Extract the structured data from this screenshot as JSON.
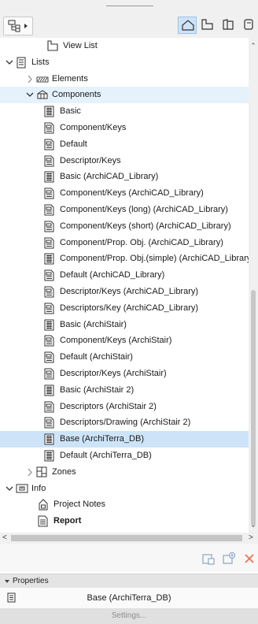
{
  "toolbar": {
    "nav_icon": "navigator-tree-icon",
    "map_buttons": [
      {
        "icon": "project-map-icon",
        "active": true
      },
      {
        "icon": "view-map-icon",
        "active": false
      },
      {
        "icon": "layout-book-icon",
        "active": false
      },
      {
        "icon": "publisher-sets-icon",
        "active": false
      }
    ]
  },
  "tree": {
    "rows": [
      {
        "label": "View List",
        "level": 2,
        "caret": "none",
        "icon": "view-list-icon",
        "bold": false
      },
      {
        "label": "Lists",
        "level": 1,
        "caret": "down",
        "icon": "lists-icon",
        "bold": false
      },
      {
        "label": "Elements",
        "level": 2,
        "caret": "right",
        "icon": "elements-folder-icon",
        "bold": false
      },
      {
        "label": "Components",
        "level": 2,
        "caret": "down",
        "icon": "components-folder-icon",
        "bold": false,
        "hover": true
      },
      {
        "label": "Basic",
        "level": 3,
        "caret": "none",
        "icon": "list-scheme-icon",
        "bold": false
      },
      {
        "label": "Component/Keys",
        "level": 3,
        "caret": "none",
        "icon": "list-doc-icon",
        "bold": false
      },
      {
        "label": "Default",
        "level": 3,
        "caret": "none",
        "icon": "list-doc-icon",
        "bold": false
      },
      {
        "label": "Descriptor/Keys",
        "level": 3,
        "caret": "none",
        "icon": "list-doc-icon",
        "bold": false
      },
      {
        "label": "Basic (ArchiCAD_Library)",
        "level": 3,
        "caret": "none",
        "icon": "list-scheme-icon",
        "bold": false
      },
      {
        "label": "Component/Keys (ArchiCAD_Library)",
        "level": 3,
        "caret": "none",
        "icon": "list-doc-icon",
        "bold": false
      },
      {
        "label": "Component/Keys (long) (ArchiCAD_Library)",
        "level": 3,
        "caret": "none",
        "icon": "list-doc-icon",
        "bold": false
      },
      {
        "label": "Component/Keys (short) (ArchiCAD_Library)",
        "level": 3,
        "caret": "none",
        "icon": "list-doc-icon",
        "bold": false
      },
      {
        "label": "Component/Prop. Obj. (ArchiCAD_Library)",
        "level": 3,
        "caret": "none",
        "icon": "list-doc-icon",
        "bold": false
      },
      {
        "label": "Component/Prop. Obj.(simple) (ArchiCAD_Library)",
        "level": 3,
        "caret": "none",
        "icon": "list-scheme-icon",
        "bold": false
      },
      {
        "label": "Default (ArchiCAD_Library)",
        "level": 3,
        "caret": "none",
        "icon": "list-doc-icon",
        "bold": false
      },
      {
        "label": "Descriptor/Keys (ArchiCAD_Library)",
        "level": 3,
        "caret": "none",
        "icon": "list-doc-icon",
        "bold": false
      },
      {
        "label": "Descriptors/Key (ArchiCAD_Library)",
        "level": 3,
        "caret": "none",
        "icon": "list-doc-icon",
        "bold": false
      },
      {
        "label": "Basic (ArchiStair)",
        "level": 3,
        "caret": "none",
        "icon": "list-scheme-icon",
        "bold": false
      },
      {
        "label": "Component/Keys (ArchiStair)",
        "level": 3,
        "caret": "none",
        "icon": "list-doc-icon",
        "bold": false
      },
      {
        "label": "Default (ArchiStair)",
        "level": 3,
        "caret": "none",
        "icon": "list-doc-icon",
        "bold": false
      },
      {
        "label": "Descriptor/Keys (ArchiStair)",
        "level": 3,
        "caret": "none",
        "icon": "list-doc-icon",
        "bold": false
      },
      {
        "label": "Basic (ArchiStair 2)",
        "level": 3,
        "caret": "none",
        "icon": "list-scheme-icon",
        "bold": false
      },
      {
        "label": "Descriptors (ArchiStair 2)",
        "level": 3,
        "caret": "none",
        "icon": "list-doc-icon",
        "bold": false
      },
      {
        "label": "Descriptors/Drawing (ArchiStair 2)",
        "level": 3,
        "caret": "none",
        "icon": "list-doc-icon",
        "bold": false
      },
      {
        "label": "Base (ArchiTerra_DB)",
        "level": 3,
        "caret": "none",
        "icon": "list-scheme-icon",
        "bold": false,
        "selected": true
      },
      {
        "label": "Default (ArchiTerra_DB)",
        "level": 3,
        "caret": "none",
        "icon": "list-scheme-icon",
        "bold": false
      },
      {
        "label": "Zones",
        "level": 2,
        "caret": "right",
        "icon": "zones-folder-icon",
        "bold": false
      },
      {
        "label": "Info",
        "level": 1,
        "caret": "down",
        "icon": "info-icon",
        "bold": false
      },
      {
        "label": "Project Notes",
        "level": 2,
        "caret": "none",
        "icon": "project-notes-icon",
        "bold": false
      },
      {
        "label": "Report",
        "level": 2,
        "caret": "none",
        "icon": "report-icon",
        "bold": true
      }
    ]
  },
  "actions": {
    "new_layout_icon": "new-layout-icon",
    "new_folder_icon": "new-subset-icon",
    "delete_icon": "delete-icon",
    "delete_color": "#e8735a"
  },
  "properties": {
    "header": "Properties",
    "item_name": "Base (ArchiTerra_DB)",
    "settings_label": "Settings..."
  },
  "colors": {
    "selected_row": "#cde4f8",
    "active_map_button": "#cfe3f6"
  }
}
